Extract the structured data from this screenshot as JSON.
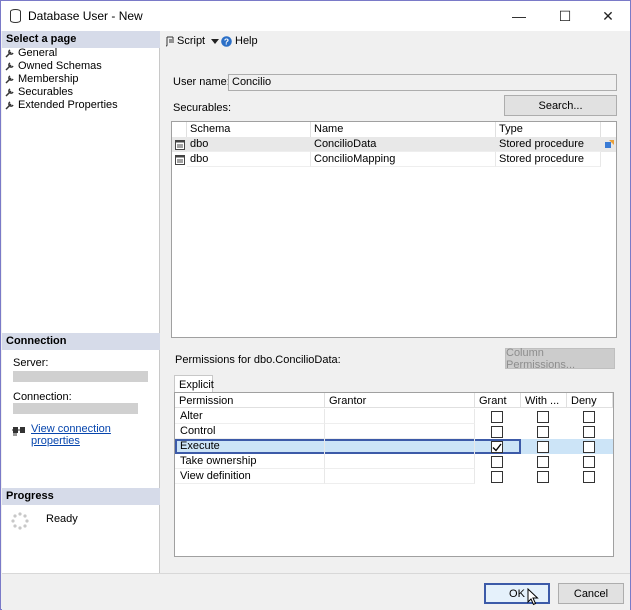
{
  "window": {
    "title": "Database User - New",
    "minimize": "—",
    "maximize": "☐",
    "close": "✕"
  },
  "left": {
    "select_page_header": "Select a page",
    "pages": [
      {
        "label": "General"
      },
      {
        "label": "Owned Schemas"
      },
      {
        "label": "Membership"
      },
      {
        "label": "Securables"
      },
      {
        "label": "Extended Properties"
      }
    ],
    "connection_header": "Connection",
    "server_label": "Server:",
    "connection_label": "Connection:",
    "view_connection_link": "View connection properties",
    "progress_header": "Progress",
    "progress_status": "Ready"
  },
  "toolbar": {
    "script_label": "Script",
    "help_label": "Help"
  },
  "form": {
    "user_name_label": "User name:",
    "user_name_value": "Concilio",
    "securables_label": "Securables:",
    "search_button": "Search..."
  },
  "securables": {
    "columns": [
      "Schema",
      "Name",
      "Type"
    ],
    "rows": [
      {
        "schema": "dbo",
        "name": "ConcilioData",
        "type": "Stored procedure"
      },
      {
        "schema": "dbo",
        "name": "ConcilioMapping",
        "type": "Stored procedure"
      }
    ]
  },
  "permissions": {
    "label": "Permissions for dbo.ConcilioData:",
    "column_permissions_button": "Column Permissions...",
    "tab_label": "Explicit",
    "columns": [
      "Permission",
      "Grantor",
      "Grant",
      "With ...",
      "Deny"
    ],
    "rows": [
      {
        "permission": "Alter",
        "grantor": "",
        "grant": false,
        "with": false,
        "deny": false
      },
      {
        "permission": "Control",
        "grantor": "",
        "grant": false,
        "with": false,
        "deny": false
      },
      {
        "permission": "Execute",
        "grantor": "",
        "grant": true,
        "with": false,
        "deny": false
      },
      {
        "permission": "Take ownership",
        "grantor": "",
        "grant": false,
        "with": false,
        "deny": false
      },
      {
        "permission": "View definition",
        "grantor": "",
        "grant": false,
        "with": false,
        "deny": false
      }
    ],
    "selected_row": "Execute"
  },
  "buttons": {
    "ok": "OK",
    "cancel": "Cancel"
  },
  "colors": {
    "header_bg": "#d6dbe9",
    "selected_row_bg": "#cce4f7",
    "selected_row_border": "#3c5aa8",
    "link": "#0645ad"
  }
}
